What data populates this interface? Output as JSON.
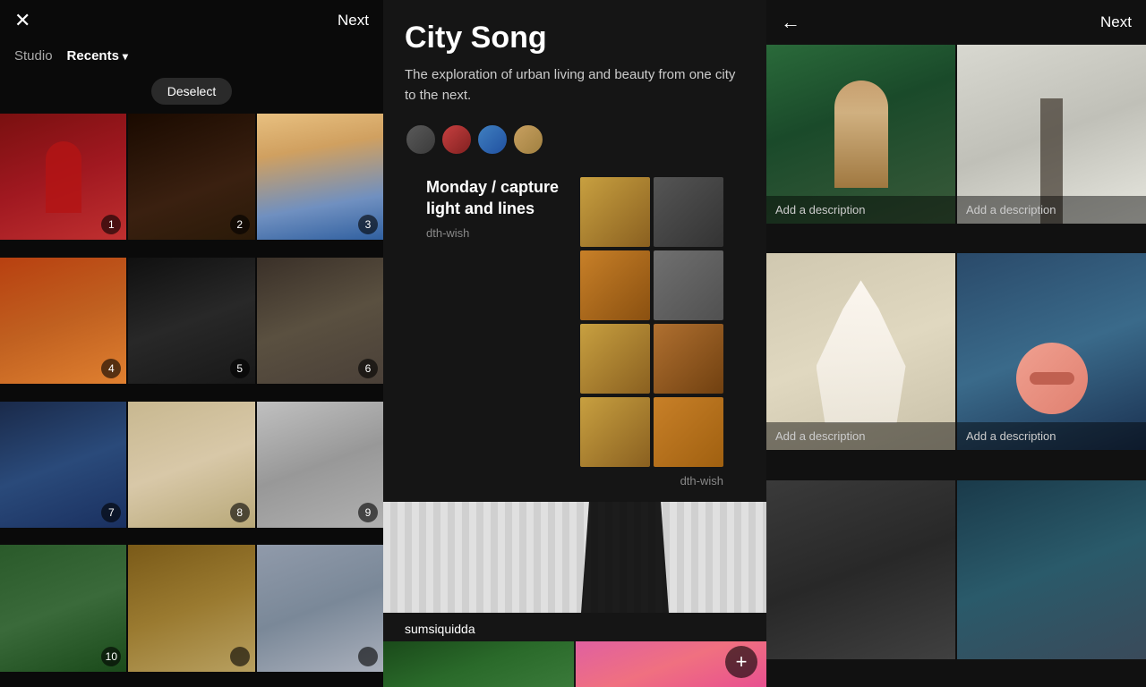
{
  "left": {
    "close_icon": "✕",
    "next_label": "Next",
    "nav_studio": "Studio",
    "nav_recents": "Recents",
    "chevron": "▾",
    "deselect": "Deselect",
    "photos": [
      {
        "num": "1",
        "color": "p1"
      },
      {
        "num": "2",
        "color": "p2"
      },
      {
        "num": "3",
        "color": "p3"
      },
      {
        "num": "4",
        "color": "p4"
      },
      {
        "num": "5",
        "color": "p5"
      },
      {
        "num": "6",
        "color": "p6"
      },
      {
        "num": "7",
        "color": "p7"
      },
      {
        "num": "8",
        "color": "p8"
      },
      {
        "num": "9",
        "color": "p9"
      },
      {
        "num": "10",
        "color": "p10"
      },
      {
        "num": "",
        "color": "p11"
      },
      {
        "num": "",
        "color": "p12"
      }
    ]
  },
  "middle": {
    "title": "City Song",
    "description": "The exploration of urban living and beauty from one city to the next.",
    "post_title": "Monday / capture light and lines",
    "author1": "dth-wish",
    "author2": "dth-wish",
    "img_author": "sumsiquidda",
    "plus_icon": "+"
  },
  "right": {
    "back_icon": "←",
    "next_label": "Next",
    "add_desc1": "Add a description",
    "add_desc2": "Add a description",
    "add_desc3": "Add a description",
    "add_desc4": "Add a description"
  }
}
